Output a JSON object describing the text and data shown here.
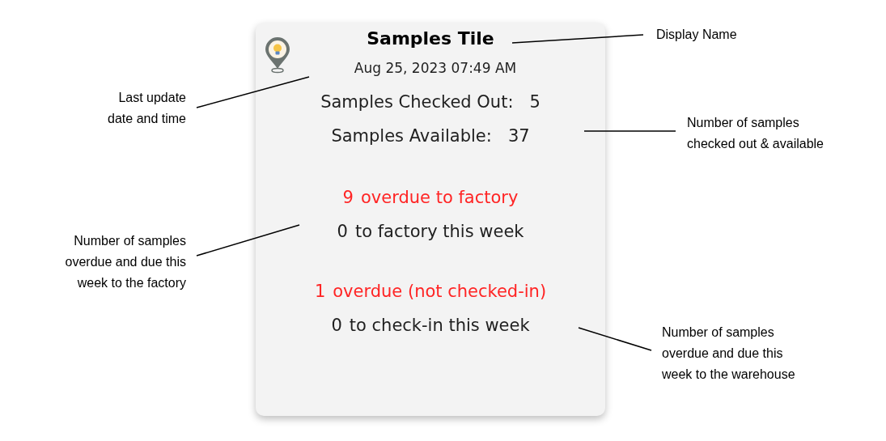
{
  "tile": {
    "title": "Samples Tile",
    "timestamp": "Aug 25, 2023 07:49 AM",
    "stats": [
      {
        "label": "Samples Checked Out:",
        "value": "5"
      },
      {
        "label": "Samples Available:",
        "value": "37"
      }
    ],
    "groups": [
      {
        "overdue_count": "9",
        "overdue_label": "overdue to factory",
        "week_count": "0",
        "week_label": "to factory this week"
      },
      {
        "overdue_count": "1",
        "overdue_label": "overdue (not checked-in)",
        "week_count": "0",
        "week_label": "to check-in this week"
      }
    ]
  },
  "annotations": [
    {
      "lines": [
        "Display Name"
      ]
    },
    {
      "lines": [
        "Last update",
        "date and time"
      ]
    },
    {
      "lines": [
        "Number of samples",
        "checked out & available"
      ]
    },
    {
      "lines": [
        "Number of samples",
        "overdue and due this",
        "week to the factory"
      ]
    },
    {
      "lines": [
        "Number of samples",
        "overdue and due this",
        "week to the warehouse"
      ]
    }
  ]
}
